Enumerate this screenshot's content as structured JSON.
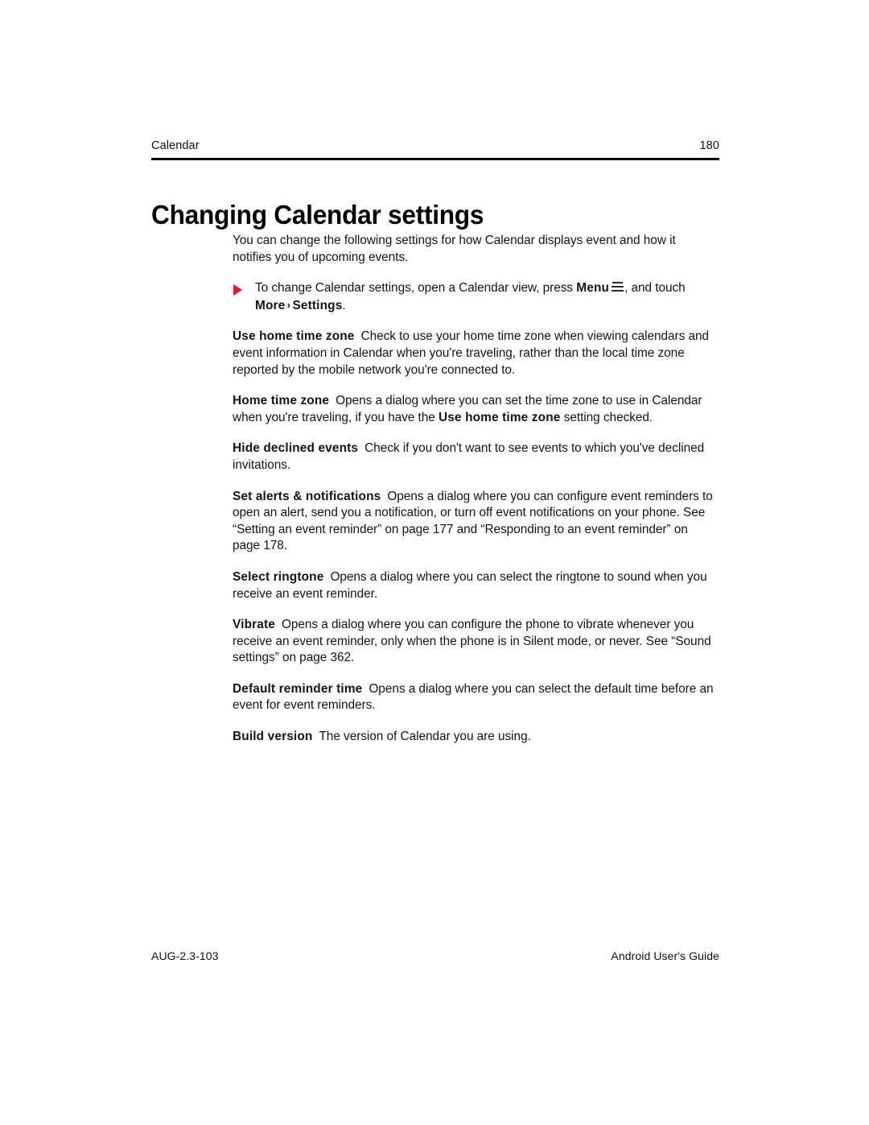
{
  "header": {
    "chapter": "Calendar",
    "page_number": "180"
  },
  "title": "Changing Calendar settings",
  "intro": {
    "paragraph": "You can change the following settings for how Calendar displays event and how it notifies you of upcoming events."
  },
  "procedure": {
    "bullet_icon": "red-triangle-bullet",
    "text_before_bold": "To change Calendar settings, open a Calendar view, press ",
    "bold_menu": "Menu",
    "menu_icon": "menu-hamburger-icon",
    "text_after_icon": ", and touch ",
    "bold_more": "More",
    "chevron": "›",
    "bold_settings": "Settings",
    "trailing_period": "."
  },
  "settings": [
    {
      "term": "Use home time zone",
      "description": "Check to use your home time zone when viewing calendars and event information in Calendar when you're traveling, rather than the local time zone reported by the mobile network you're connected to."
    },
    {
      "term": "Home time zone",
      "description_before": "Opens a dialog where you can set the time zone to use in Calendar when you're traveling, if you have the ",
      "description_bold": "Use home time zone",
      "description_after": " setting checked."
    },
    {
      "term": "Hide declined events",
      "description": "Check if you don't want to see events to which you've declined invitations."
    },
    {
      "term": "Set alerts & notifications",
      "description": "Opens a dialog where you can configure event reminders to open an alert, send you a notification, or turn off event notifications on your phone. See “Setting an event reminder” on page 177 and “Responding to an event reminder” on page 178."
    },
    {
      "term": "Select ringtone",
      "description": "Opens a dialog where you can select the ringtone to sound when you receive an event reminder."
    },
    {
      "term": "Vibrate",
      "description": "Opens a dialog where you can configure the phone to vibrate whenever you receive an event reminder, only when the phone is in Silent mode, or never. See “Sound settings” on page 362."
    },
    {
      "term": "Default reminder time",
      "description": "Opens a dialog where you can select the default time before an event for event reminders."
    },
    {
      "term": "Build version",
      "description": "The version of Calendar you are using."
    }
  ],
  "footer": {
    "doc_code": "AUG-2.3-103",
    "doc_title": "Android User's Guide"
  },
  "colors": {
    "bullet_red": "#e8142a",
    "rule_black": "#000000",
    "text": "#141414"
  }
}
